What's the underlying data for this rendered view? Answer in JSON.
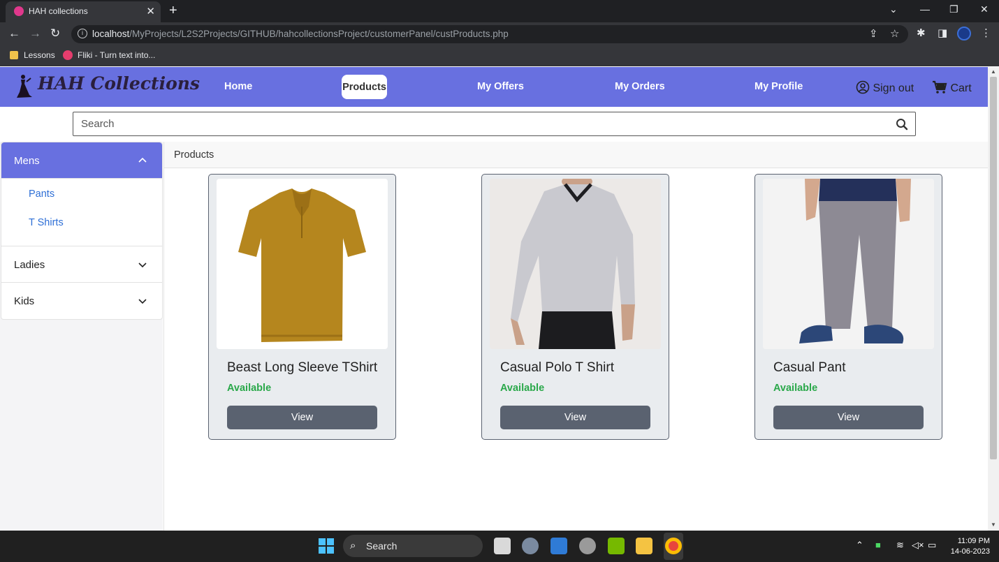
{
  "browser": {
    "tab_title": "HAH collections",
    "url_host": "localhost",
    "url_path": "/MyProjects/L2S2Projects/GITHUB/hahcollectionsProject/customerPanel/custProducts.php",
    "bookmarks": [
      "Lessons",
      "Fliki - Turn text into..."
    ]
  },
  "navbar": {
    "brand": "HAH Collections",
    "links": [
      "Home",
      "Products",
      "My Offers",
      "My Orders",
      "My Profile"
    ],
    "active": "Products",
    "sign_out": "Sign out",
    "cart": "Cart",
    "accent_color": "#6870e0"
  },
  "search": {
    "placeholder": "Search"
  },
  "sidebar": {
    "categories": [
      {
        "label": "Mens",
        "expanded": true,
        "items": [
          "Pants",
          "T Shirts"
        ]
      },
      {
        "label": "Ladies",
        "expanded": false
      },
      {
        "label": "Kids",
        "expanded": false
      }
    ]
  },
  "products_panel": {
    "title": "Products",
    "items": [
      {
        "name": "Beast Long Sleeve TShirt",
        "status": "Available",
        "button": "View"
      },
      {
        "name": "Casual Polo T Shirt",
        "status": "Available",
        "button": "View"
      },
      {
        "name": "Casual Pant",
        "status": "Available",
        "button": "View"
      }
    ]
  },
  "taskbar": {
    "search_label": "Search",
    "time": "11:09 PM",
    "date": "14-06-2023"
  }
}
